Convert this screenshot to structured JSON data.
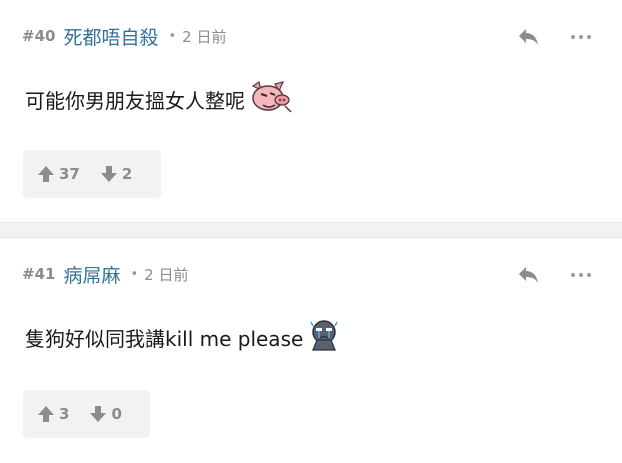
{
  "posts": [
    {
      "number": "#40",
      "username": "死都唔自殺",
      "separator": "•",
      "time": "2 日前",
      "content": "可能你男朋友搵女人整呢",
      "emoji": "pig-face-icon",
      "upvotes": "37",
      "downvotes": "2"
    },
    {
      "number": "#41",
      "username": "病屌麻",
      "separator": "•",
      "time": "2 日前",
      "content": "隻狗好似同我講kill me please",
      "emoji": "crying-face-icon",
      "upvotes": "3",
      "downvotes": "0"
    }
  ],
  "colors": {
    "username": "#34719b",
    "meta": "#8c8c8c",
    "vote_bg": "#f2f2f2",
    "separator_bg": "#f2f2f2"
  }
}
